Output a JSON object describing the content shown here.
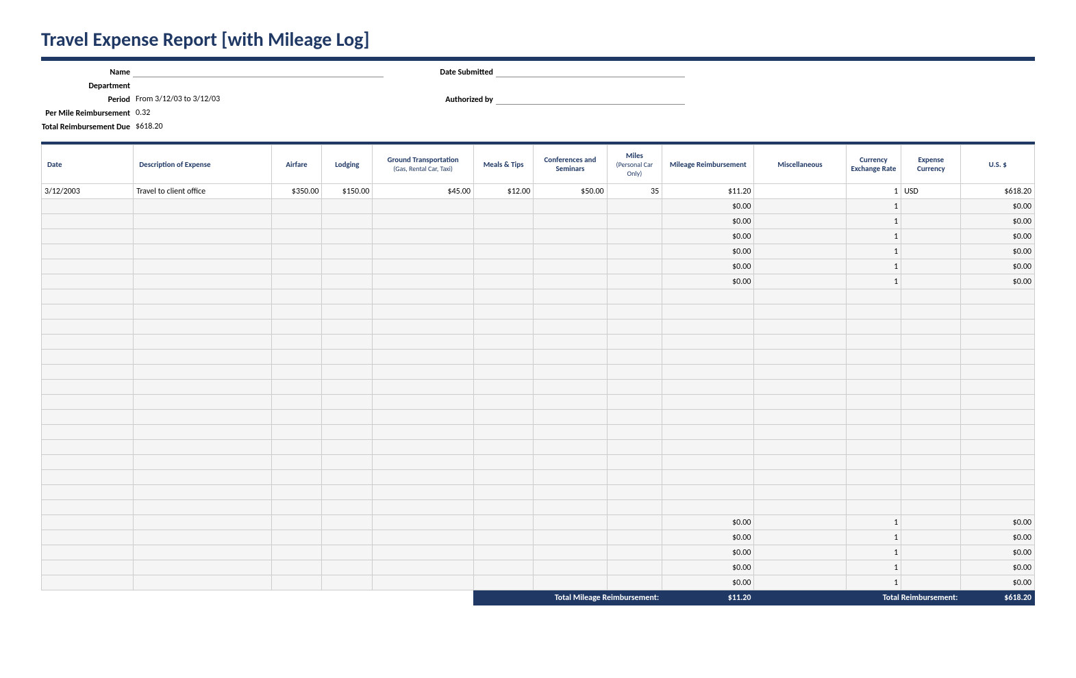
{
  "title": "Travel Expense Report [with Mileage Log]",
  "header": {
    "name_label": "Name",
    "name_value": "",
    "department_label": "Department",
    "department_value": "",
    "period_label": "Period",
    "period_value": "From 3/12/03 to 3/12/03",
    "permile_label": "Per Mile Reimbursement",
    "permile_value": "0.32",
    "totaldue_label": "Total Reimbursement Due",
    "totaldue_value": "$618.20",
    "datesubmitted_label": "Date Submitted",
    "datesubmitted_value": "",
    "authorized_label": "Authorized by",
    "authorized_value": ""
  },
  "columns": {
    "date": "Date",
    "description": "Description of Expense",
    "airfare": "Airfare",
    "lodging": "Lodging",
    "ground": "Ground Transportation",
    "ground_sub": "(Gas, Rental Car, Taxi)",
    "meals": "Meals & Tips",
    "conferences": "Conferences and Seminars",
    "miles": "Miles",
    "miles_sub": "(Personal Car Only)",
    "mileage_reimb": "Mileage Reimbursement",
    "miscellaneous": "Miscellaneous",
    "exchange": "Currency Exchange Rate",
    "currency": "Expense Currency",
    "us": "U.S. $"
  },
  "rows": [
    {
      "date": "3/12/2003",
      "description": "Travel to client office",
      "airfare": "$350.00",
      "lodging": "$150.00",
      "ground": "$45.00",
      "meals": "$12.00",
      "conferences": "$50.00",
      "miles": "35",
      "mileage_reimb": "$11.20",
      "miscellaneous": "",
      "exchange": "1",
      "currency": "USD",
      "us": "$618.20"
    },
    {
      "date": "",
      "description": "",
      "airfare": "",
      "lodging": "",
      "ground": "",
      "meals": "",
      "conferences": "",
      "miles": "",
      "mileage_reimb": "$0.00",
      "miscellaneous": "",
      "exchange": "1",
      "currency": "",
      "us": "$0.00"
    },
    {
      "date": "",
      "description": "",
      "airfare": "",
      "lodging": "",
      "ground": "",
      "meals": "",
      "conferences": "",
      "miles": "",
      "mileage_reimb": "$0.00",
      "miscellaneous": "",
      "exchange": "1",
      "currency": "",
      "us": "$0.00"
    },
    {
      "date": "",
      "description": "",
      "airfare": "",
      "lodging": "",
      "ground": "",
      "meals": "",
      "conferences": "",
      "miles": "",
      "mileage_reimb": "$0.00",
      "miscellaneous": "",
      "exchange": "1",
      "currency": "",
      "us": "$0.00"
    },
    {
      "date": "",
      "description": "",
      "airfare": "",
      "lodging": "",
      "ground": "",
      "meals": "",
      "conferences": "",
      "miles": "",
      "mileage_reimb": "$0.00",
      "miscellaneous": "",
      "exchange": "1",
      "currency": "",
      "us": "$0.00"
    },
    {
      "date": "",
      "description": "",
      "airfare": "",
      "lodging": "",
      "ground": "",
      "meals": "",
      "conferences": "",
      "miles": "",
      "mileage_reimb": "$0.00",
      "miscellaneous": "",
      "exchange": "1",
      "currency": "",
      "us": "$0.00"
    },
    {
      "date": "",
      "description": "",
      "airfare": "",
      "lodging": "",
      "ground": "",
      "meals": "",
      "conferences": "",
      "miles": "",
      "mileage_reimb": "$0.00",
      "miscellaneous": "",
      "exchange": "1",
      "currency": "",
      "us": "$0.00"
    },
    {
      "date": "",
      "description": "",
      "airfare": "",
      "lodging": "",
      "ground": "",
      "meals": "",
      "conferences": "",
      "miles": "",
      "mileage_reimb": "",
      "miscellaneous": "",
      "exchange": "",
      "currency": "",
      "us": ""
    },
    {
      "date": "",
      "description": "",
      "airfare": "",
      "lodging": "",
      "ground": "",
      "meals": "",
      "conferences": "",
      "miles": "",
      "mileage_reimb": "",
      "miscellaneous": "",
      "exchange": "",
      "currency": "",
      "us": ""
    },
    {
      "date": "",
      "description": "",
      "airfare": "",
      "lodging": "",
      "ground": "",
      "meals": "",
      "conferences": "",
      "miles": "",
      "mileage_reimb": "",
      "miscellaneous": "",
      "exchange": "",
      "currency": "",
      "us": ""
    },
    {
      "date": "",
      "description": "",
      "airfare": "",
      "lodging": "",
      "ground": "",
      "meals": "",
      "conferences": "",
      "miles": "",
      "mileage_reimb": "",
      "miscellaneous": "",
      "exchange": "",
      "currency": "",
      "us": ""
    },
    {
      "date": "",
      "description": "",
      "airfare": "",
      "lodging": "",
      "ground": "",
      "meals": "",
      "conferences": "",
      "miles": "",
      "mileage_reimb": "",
      "miscellaneous": "",
      "exchange": "",
      "currency": "",
      "us": ""
    },
    {
      "date": "",
      "description": "",
      "airfare": "",
      "lodging": "",
      "ground": "",
      "meals": "",
      "conferences": "",
      "miles": "",
      "mileage_reimb": "",
      "miscellaneous": "",
      "exchange": "",
      "currency": "",
      "us": ""
    },
    {
      "date": "",
      "description": "",
      "airfare": "",
      "lodging": "",
      "ground": "",
      "meals": "",
      "conferences": "",
      "miles": "",
      "mileage_reimb": "",
      "miscellaneous": "",
      "exchange": "",
      "currency": "",
      "us": ""
    },
    {
      "date": "",
      "description": "",
      "airfare": "",
      "lodging": "",
      "ground": "",
      "meals": "",
      "conferences": "",
      "miles": "",
      "mileage_reimb": "",
      "miscellaneous": "",
      "exchange": "",
      "currency": "",
      "us": ""
    },
    {
      "date": "",
      "description": "",
      "airfare": "",
      "lodging": "",
      "ground": "",
      "meals": "",
      "conferences": "",
      "miles": "",
      "mileage_reimb": "",
      "miscellaneous": "",
      "exchange": "",
      "currency": "",
      "us": ""
    },
    {
      "date": "",
      "description": "",
      "airfare": "",
      "lodging": "",
      "ground": "",
      "meals": "",
      "conferences": "",
      "miles": "",
      "mileage_reimb": "",
      "miscellaneous": "",
      "exchange": "",
      "currency": "",
      "us": ""
    },
    {
      "date": "",
      "description": "",
      "airfare": "",
      "lodging": "",
      "ground": "",
      "meals": "",
      "conferences": "",
      "miles": "",
      "mileage_reimb": "",
      "miscellaneous": "",
      "exchange": "",
      "currency": "",
      "us": ""
    },
    {
      "date": "",
      "description": "",
      "airfare": "",
      "lodging": "",
      "ground": "",
      "meals": "",
      "conferences": "",
      "miles": "",
      "mileage_reimb": "",
      "miscellaneous": "",
      "exchange": "",
      "currency": "",
      "us": ""
    },
    {
      "date": "",
      "description": "",
      "airfare": "",
      "lodging": "",
      "ground": "",
      "meals": "",
      "conferences": "",
      "miles": "",
      "mileage_reimb": "",
      "miscellaneous": "",
      "exchange": "",
      "currency": "",
      "us": ""
    },
    {
      "date": "",
      "description": "",
      "airfare": "",
      "lodging": "",
      "ground": "",
      "meals": "",
      "conferences": "",
      "miles": "",
      "mileage_reimb": "",
      "miscellaneous": "",
      "exchange": "",
      "currency": "",
      "us": ""
    },
    {
      "date": "",
      "description": "",
      "airfare": "",
      "lodging": "",
      "ground": "",
      "meals": "",
      "conferences": "",
      "miles": "",
      "mileage_reimb": "",
      "miscellaneous": "",
      "exchange": "",
      "currency": "",
      "us": ""
    },
    {
      "date": "",
      "description": "",
      "airfare": "",
      "lodging": "",
      "ground": "",
      "meals": "",
      "conferences": "",
      "miles": "",
      "mileage_reimb": "$0.00",
      "miscellaneous": "",
      "exchange": "1",
      "currency": "",
      "us": "$0.00"
    },
    {
      "date": "",
      "description": "",
      "airfare": "",
      "lodging": "",
      "ground": "",
      "meals": "",
      "conferences": "",
      "miles": "",
      "mileage_reimb": "$0.00",
      "miscellaneous": "",
      "exchange": "1",
      "currency": "",
      "us": "$0.00"
    },
    {
      "date": "",
      "description": "",
      "airfare": "",
      "lodging": "",
      "ground": "",
      "meals": "",
      "conferences": "",
      "miles": "",
      "mileage_reimb": "$0.00",
      "miscellaneous": "",
      "exchange": "1",
      "currency": "",
      "us": "$0.00"
    },
    {
      "date": "",
      "description": "",
      "airfare": "",
      "lodging": "",
      "ground": "",
      "meals": "",
      "conferences": "",
      "miles": "",
      "mileage_reimb": "$0.00",
      "miscellaneous": "",
      "exchange": "1",
      "currency": "",
      "us": "$0.00"
    },
    {
      "date": "",
      "description": "",
      "airfare": "",
      "lodging": "",
      "ground": "",
      "meals": "",
      "conferences": "",
      "miles": "",
      "mileage_reimb": "$0.00",
      "miscellaneous": "",
      "exchange": "1",
      "currency": "",
      "us": "$0.00"
    }
  ],
  "footer": {
    "mileage_label": "Total Mileage Reimbursement:",
    "mileage_value": "$11.20",
    "total_label": "Total Reimbursement:",
    "total_value": "$618.20"
  }
}
